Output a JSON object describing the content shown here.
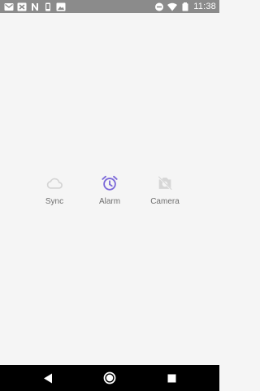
{
  "status_bar": {
    "time": "11:38",
    "left_icons": [
      "gmail-icon",
      "crossed-arrows-icon",
      "n-notification-icon",
      "phone-icon",
      "photo-icon"
    ],
    "right_icons": [
      "do-not-disturb-icon",
      "wifi-icon",
      "battery-icon"
    ]
  },
  "items": [
    {
      "label": "Sync",
      "icon": "cloud-icon",
      "color": "#d3d3d3"
    },
    {
      "label": "Alarm",
      "icon": "alarm-clock-icon",
      "color": "#7b68d9"
    },
    {
      "label": "Camera",
      "icon": "camera-off-icon",
      "color": "#d6d6d6"
    }
  ],
  "colors": {
    "status_bar": "#8b8b8b",
    "background": "#f5f5f5",
    "label": "#6e6e6e",
    "accent": "#7b68d9",
    "nav_bar": "#000000"
  },
  "nav_bar": [
    "back-icon",
    "home-icon",
    "recents-icon"
  ]
}
